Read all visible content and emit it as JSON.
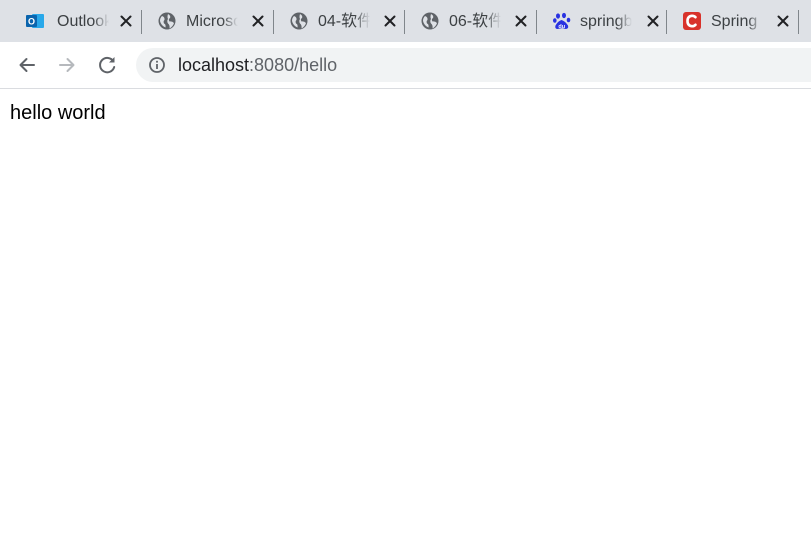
{
  "tabs": [
    {
      "title": "Outlook",
      "favicon": "outlook-icon",
      "close_glyph": "✕"
    },
    {
      "title": "Microsoft",
      "favicon": "globe-icon",
      "close_glyph": "✕"
    },
    {
      "title": "04-软件",
      "favicon": "globe-icon",
      "close_glyph": "✕"
    },
    {
      "title": "06-软件",
      "favicon": "globe-icon",
      "close_glyph": "✕"
    },
    {
      "title": "springboot",
      "favicon": "baidu-paw-icon",
      "close_glyph": "✕"
    },
    {
      "title": "Spring",
      "favicon": "csdn-c-icon",
      "close_glyph": "✕"
    }
  ],
  "toolbar": {
    "back": "back-arrow-icon",
    "forward": "forward-arrow-icon",
    "reload": "reload-icon"
  },
  "address_bar": {
    "host": "localhost",
    "rest": ":8080/hello",
    "security_icon": "info-icon"
  },
  "page": {
    "body_text": "hello world"
  },
  "colors": {
    "tabstrip_bg": "#dee1e6",
    "omnibox_bg": "#f1f3f4",
    "outlook_blue": "#0a64ad",
    "baidu_blue": "#2932e1",
    "csdn_red": "#d8322b"
  }
}
